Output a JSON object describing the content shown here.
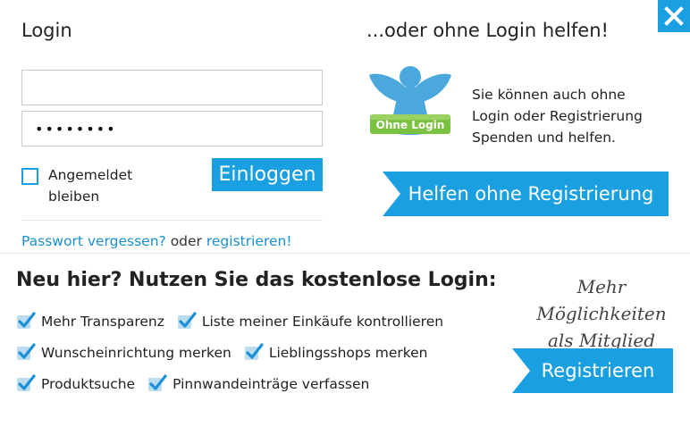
{
  "login": {
    "title": "Login",
    "username_value": "",
    "password_value": "••••••••",
    "remember_label": "Angemeldet bleiben",
    "submit_label": "Einloggen",
    "forgot_label": "Passwort vergessen?",
    "or_label": " oder ",
    "register_label": "registrieren!"
  },
  "guest": {
    "title": "...oder ohne Login helfen!",
    "badge_text": "Ohne Login",
    "description": "Sie können auch ohne Login oder Registrierung Spenden und helfen.",
    "button_label": "Helfen ohne Registrierung"
  },
  "signup": {
    "title": "Neu hier? Nutzen Sie das kostenlose Login:",
    "features": [
      [
        "Mehr Transparenz",
        "Liste meiner Einkäufe kontrollieren"
      ],
      [
        "Wunscheinrichtung merken",
        "Lieblingsshops merken"
      ],
      [
        "Produktsuche",
        "Pinnwandeinträge verfassen"
      ]
    ],
    "script_line1": "Mehr Möglichkeiten",
    "script_line2": "als Mitglied",
    "button_label": "Registrieren"
  },
  "colors": {
    "accent": "#1a9fe0",
    "badge_green": "#7cc242",
    "angel_blue": "#4aa8dd"
  },
  "icons": {
    "close": "close-icon",
    "check": "check-icon",
    "angel": "angel-icon"
  }
}
